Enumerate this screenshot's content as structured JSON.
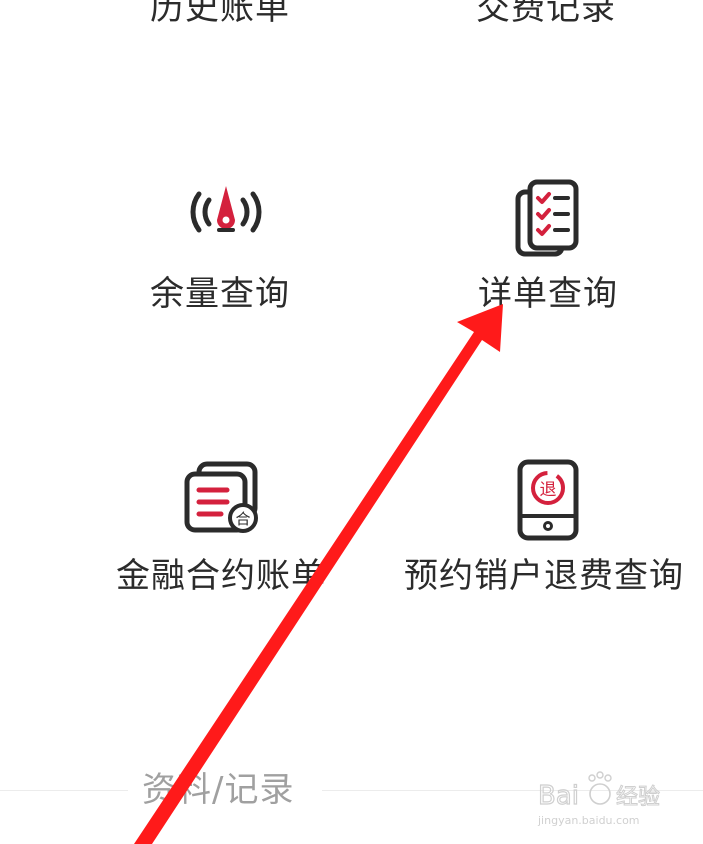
{
  "menu": {
    "top_row": [
      {
        "label": "历史账单"
      },
      {
        "label": "交费记录"
      }
    ],
    "items": [
      {
        "label": "余量查询",
        "icon": "gauge-icon"
      },
      {
        "label": "详单查询",
        "icon": "checklist-icon"
      },
      {
        "label": "金融合约账单",
        "icon": "contract-bill-icon"
      },
      {
        "label": "预约销户退费查询",
        "icon": "phone-refund-icon"
      }
    ]
  },
  "section": {
    "title": "资料/记录"
  },
  "icon_badges": {
    "contract": "合",
    "refund": "退"
  },
  "watermark": {
    "brand": "Bai",
    "brand_suffix": "经验",
    "url": "jingyan.baidu.com"
  },
  "colors": {
    "accent": "#d4213d",
    "icon_stroke": "#2b2b2b",
    "arrow": "#ff1a1a",
    "text": "#2b2b2b",
    "muted": "#a0a0a0"
  }
}
